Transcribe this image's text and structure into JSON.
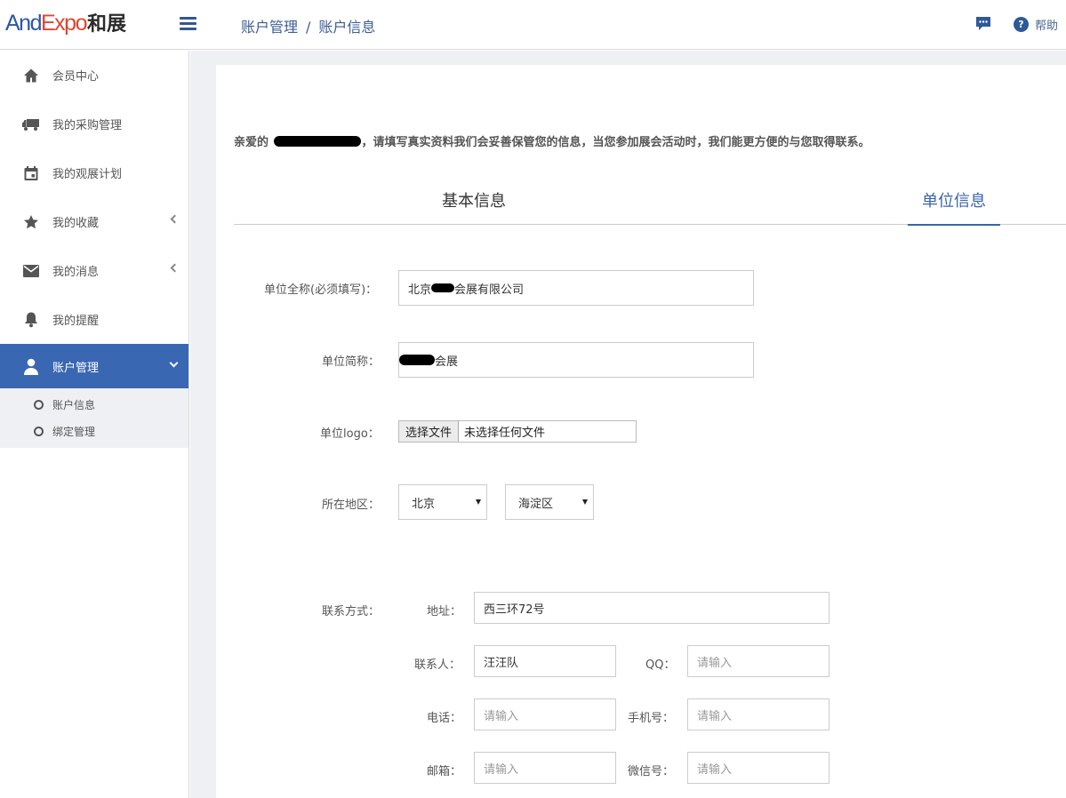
{
  "header": {
    "logo": {
      "part1": "And",
      "part2": "Expo",
      "part3": "和展"
    },
    "breadcrumb": {
      "parent": "账户管理",
      "separator": "/",
      "current": "账户信息"
    },
    "help_label": "帮助",
    "help_glyph": "?"
  },
  "sidebar": {
    "items": [
      {
        "label": "会员中心",
        "icon": "home-icon"
      },
      {
        "label": "我的采购管理",
        "icon": "truck-icon"
      },
      {
        "label": "我的观展计划",
        "icon": "calendar-icon"
      },
      {
        "label": "我的收藏",
        "icon": "star-icon",
        "has_chevron": true
      },
      {
        "label": "我的消息",
        "icon": "mail-icon",
        "has_chevron": true
      },
      {
        "label": "我的提醒",
        "icon": "bell-icon"
      },
      {
        "label": "账户管理",
        "icon": "user-icon",
        "active": true
      }
    ],
    "sub_items": [
      {
        "label": "账户信息"
      },
      {
        "label": "绑定管理"
      }
    ],
    "active_color": "#3a67b2"
  },
  "main": {
    "greeting_prefix": "亲爱的",
    "greeting_suffix": "，请填写真实资料我们会妥善保管您的信息，当您参加展会活动时，我们能更方便的与您取得联系。",
    "tabs": [
      {
        "label": "基本信息",
        "active": false
      },
      {
        "label": "单位信息",
        "active": true
      }
    ],
    "form": {
      "full_name_label": "单位全称(必须填写)：",
      "full_name_prefix": "北京",
      "full_name_suffix": "会展有限公司",
      "short_name_label": "单位简称：",
      "short_name_suffix": "会展",
      "logo_label": "单位logo：",
      "logo_button": "选择文件",
      "logo_status": "未选择任何文件",
      "region_label": "所在地区：",
      "province": "北京",
      "district": "海淀区",
      "contact_label": "联系方式：",
      "address_label": "地址：",
      "address_value": "西三环72号",
      "contact_person_label": "联系人：",
      "contact_person_value": "汪汪队",
      "qq_label": "QQ：",
      "qq_placeholder": "请输入",
      "phone_label": "电话：",
      "phone_placeholder": "请输入",
      "mobile_label": "手机号：",
      "mobile_placeholder": "请输入",
      "email_label": "邮箱：",
      "email_placeholder": "请输入",
      "wechat_label": "微信号：",
      "wechat_placeholder": "请输入"
    }
  }
}
